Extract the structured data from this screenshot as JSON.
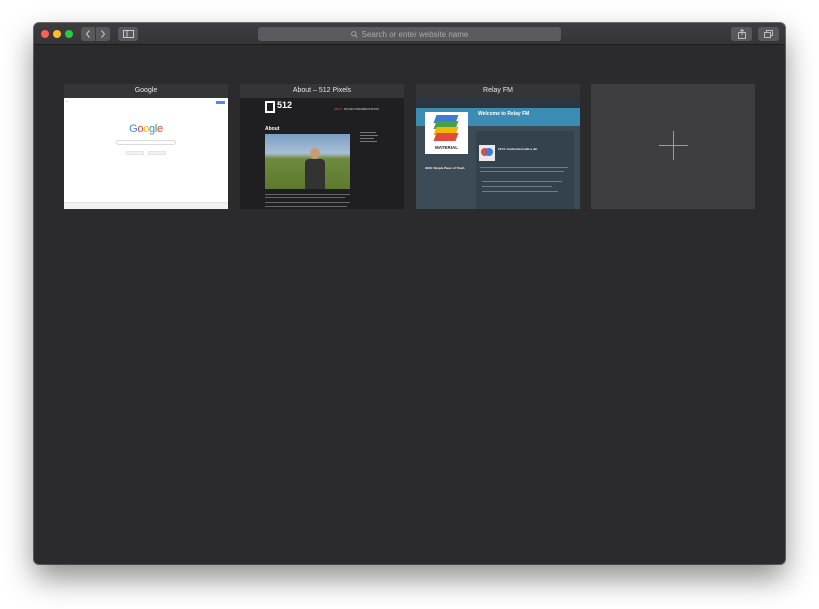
{
  "toolbar": {
    "address_placeholder": "Search or enter website name"
  },
  "top_sites": [
    {
      "title": "Google",
      "preview": {
        "logo": "Google"
      }
    },
    {
      "title": "About – 512 Pixels",
      "preview": {
        "logo_text": "512",
        "nav": [
          "ABOUT",
          "PROJECTS",
          "MEMBERSHIP",
          "RSS"
        ],
        "heading": "About"
      }
    },
    {
      "title": "Relay FM",
      "preview": {
        "headline": "Welcome to Relay FM",
        "cover_label": "MATERIAL",
        "episode": "#174: Confronted with a Jar",
        "show_episode": "#233: Simple Piece of Trash"
      }
    }
  ],
  "colors": {
    "window_bg": "#2b2b2e",
    "close": "#fe5f57",
    "minimize": "#febc2e",
    "maximize": "#28c840",
    "relay_accent": "#3b8cb3"
  },
  "icons": {
    "back": "chevron-left-icon",
    "forward": "chevron-right-icon",
    "sidebar": "sidebar-icon",
    "search": "search-icon",
    "share": "share-icon",
    "tabs": "tab-overview-icon",
    "add": "plus-icon"
  }
}
